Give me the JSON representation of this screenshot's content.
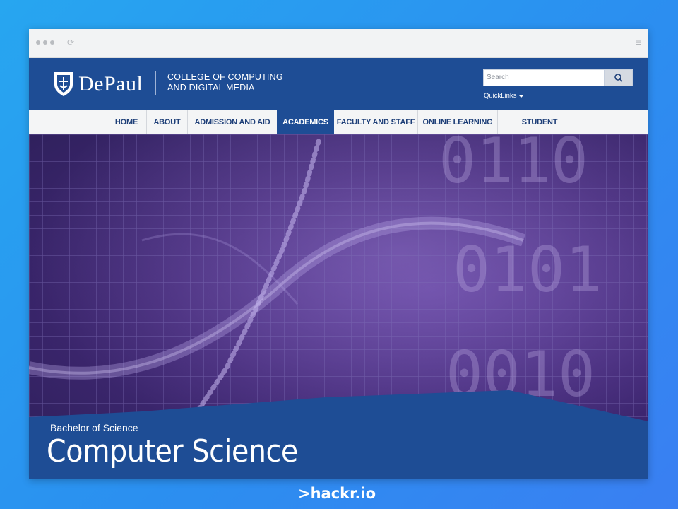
{
  "browser": {
    "dots": 3
  },
  "header": {
    "brand": "DePaul",
    "college_line1": "COLLEGE OF COMPUTING",
    "college_line2": "AND DIGITAL MEDIA",
    "search_placeholder": "Search",
    "quicklinks_label": "QuickLinks"
  },
  "nav": {
    "items": [
      {
        "label": "HOME"
      },
      {
        "label": "ABOUT"
      },
      {
        "label": "ADMISSION AND AID"
      },
      {
        "label": "ACADEMICS",
        "active": true
      },
      {
        "label": "FACULTY AND STAFF"
      },
      {
        "label": "ONLINE LEARNING"
      },
      {
        "label": "STUDENT RESOURCES"
      }
    ]
  },
  "hero": {
    "binary_rows": [
      "0110",
      "0101",
      "0010"
    ],
    "subtitle": "Bachelor of Science",
    "title": "Computer Science"
  },
  "footer": {
    "brand": ">hackr.io"
  },
  "colors": {
    "header_bg": "#1e4d95",
    "nav_text": "#1e3f78",
    "hero_purple": "#432978",
    "page_bg": "#2b8ff0"
  },
  "icons": [
    "search-icon",
    "caret-down-icon",
    "depaul-shield-icon",
    "reload-icon",
    "menu-icon"
  ]
}
